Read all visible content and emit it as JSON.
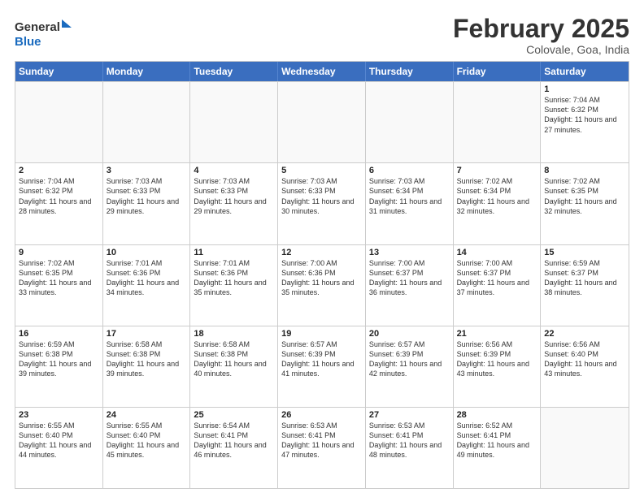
{
  "logo": {
    "line1": "General",
    "line2": "Blue"
  },
  "title": "February 2025",
  "location": "Colovale, Goa, India",
  "header": {
    "days": [
      "Sunday",
      "Monday",
      "Tuesday",
      "Wednesday",
      "Thursday",
      "Friday",
      "Saturday"
    ]
  },
  "weeks": [
    {
      "cells": [
        {
          "day": "",
          "empty": true
        },
        {
          "day": "",
          "empty": true
        },
        {
          "day": "",
          "empty": true
        },
        {
          "day": "",
          "empty": true
        },
        {
          "day": "",
          "empty": true
        },
        {
          "day": "",
          "empty": true
        },
        {
          "day": "1",
          "sunrise": "Sunrise: 7:04 AM",
          "sunset": "Sunset: 6:32 PM",
          "daylight": "Daylight: 11 hours and 27 minutes."
        }
      ]
    },
    {
      "cells": [
        {
          "day": "2",
          "sunrise": "Sunrise: 7:04 AM",
          "sunset": "Sunset: 6:32 PM",
          "daylight": "Daylight: 11 hours and 28 minutes."
        },
        {
          "day": "3",
          "sunrise": "Sunrise: 7:03 AM",
          "sunset": "Sunset: 6:33 PM",
          "daylight": "Daylight: 11 hours and 29 minutes."
        },
        {
          "day": "4",
          "sunrise": "Sunrise: 7:03 AM",
          "sunset": "Sunset: 6:33 PM",
          "daylight": "Daylight: 11 hours and 29 minutes."
        },
        {
          "day": "5",
          "sunrise": "Sunrise: 7:03 AM",
          "sunset": "Sunset: 6:33 PM",
          "daylight": "Daylight: 11 hours and 30 minutes."
        },
        {
          "day": "6",
          "sunrise": "Sunrise: 7:03 AM",
          "sunset": "Sunset: 6:34 PM",
          "daylight": "Daylight: 11 hours and 31 minutes."
        },
        {
          "day": "7",
          "sunrise": "Sunrise: 7:02 AM",
          "sunset": "Sunset: 6:34 PM",
          "daylight": "Daylight: 11 hours and 32 minutes."
        },
        {
          "day": "8",
          "sunrise": "Sunrise: 7:02 AM",
          "sunset": "Sunset: 6:35 PM",
          "daylight": "Daylight: 11 hours and 32 minutes."
        }
      ]
    },
    {
      "cells": [
        {
          "day": "9",
          "sunrise": "Sunrise: 7:02 AM",
          "sunset": "Sunset: 6:35 PM",
          "daylight": "Daylight: 11 hours and 33 minutes."
        },
        {
          "day": "10",
          "sunrise": "Sunrise: 7:01 AM",
          "sunset": "Sunset: 6:36 PM",
          "daylight": "Daylight: 11 hours and 34 minutes."
        },
        {
          "day": "11",
          "sunrise": "Sunrise: 7:01 AM",
          "sunset": "Sunset: 6:36 PM",
          "daylight": "Daylight: 11 hours and 35 minutes."
        },
        {
          "day": "12",
          "sunrise": "Sunrise: 7:00 AM",
          "sunset": "Sunset: 6:36 PM",
          "daylight": "Daylight: 11 hours and 35 minutes."
        },
        {
          "day": "13",
          "sunrise": "Sunrise: 7:00 AM",
          "sunset": "Sunset: 6:37 PM",
          "daylight": "Daylight: 11 hours and 36 minutes."
        },
        {
          "day": "14",
          "sunrise": "Sunrise: 7:00 AM",
          "sunset": "Sunset: 6:37 PM",
          "daylight": "Daylight: 11 hours and 37 minutes."
        },
        {
          "day": "15",
          "sunrise": "Sunrise: 6:59 AM",
          "sunset": "Sunset: 6:37 PM",
          "daylight": "Daylight: 11 hours and 38 minutes."
        }
      ]
    },
    {
      "cells": [
        {
          "day": "16",
          "sunrise": "Sunrise: 6:59 AM",
          "sunset": "Sunset: 6:38 PM",
          "daylight": "Daylight: 11 hours and 39 minutes."
        },
        {
          "day": "17",
          "sunrise": "Sunrise: 6:58 AM",
          "sunset": "Sunset: 6:38 PM",
          "daylight": "Daylight: 11 hours and 39 minutes."
        },
        {
          "day": "18",
          "sunrise": "Sunrise: 6:58 AM",
          "sunset": "Sunset: 6:38 PM",
          "daylight": "Daylight: 11 hours and 40 minutes."
        },
        {
          "day": "19",
          "sunrise": "Sunrise: 6:57 AM",
          "sunset": "Sunset: 6:39 PM",
          "daylight": "Daylight: 11 hours and 41 minutes."
        },
        {
          "day": "20",
          "sunrise": "Sunrise: 6:57 AM",
          "sunset": "Sunset: 6:39 PM",
          "daylight": "Daylight: 11 hours and 42 minutes."
        },
        {
          "day": "21",
          "sunrise": "Sunrise: 6:56 AM",
          "sunset": "Sunset: 6:39 PM",
          "daylight": "Daylight: 11 hours and 43 minutes."
        },
        {
          "day": "22",
          "sunrise": "Sunrise: 6:56 AM",
          "sunset": "Sunset: 6:40 PM",
          "daylight": "Daylight: 11 hours and 43 minutes."
        }
      ]
    },
    {
      "cells": [
        {
          "day": "23",
          "sunrise": "Sunrise: 6:55 AM",
          "sunset": "Sunset: 6:40 PM",
          "daylight": "Daylight: 11 hours and 44 minutes."
        },
        {
          "day": "24",
          "sunrise": "Sunrise: 6:55 AM",
          "sunset": "Sunset: 6:40 PM",
          "daylight": "Daylight: 11 hours and 45 minutes."
        },
        {
          "day": "25",
          "sunrise": "Sunrise: 6:54 AM",
          "sunset": "Sunset: 6:41 PM",
          "daylight": "Daylight: 11 hours and 46 minutes."
        },
        {
          "day": "26",
          "sunrise": "Sunrise: 6:53 AM",
          "sunset": "Sunset: 6:41 PM",
          "daylight": "Daylight: 11 hours and 47 minutes."
        },
        {
          "day": "27",
          "sunrise": "Sunrise: 6:53 AM",
          "sunset": "Sunset: 6:41 PM",
          "daylight": "Daylight: 11 hours and 48 minutes."
        },
        {
          "day": "28",
          "sunrise": "Sunrise: 6:52 AM",
          "sunset": "Sunset: 6:41 PM",
          "daylight": "Daylight: 11 hours and 49 minutes."
        },
        {
          "day": "",
          "empty": true
        }
      ]
    }
  ]
}
